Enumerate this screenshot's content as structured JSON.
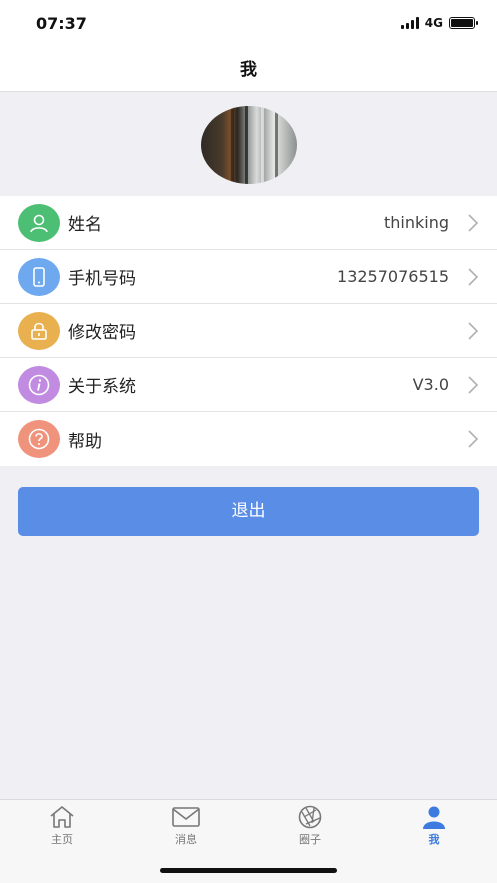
{
  "status_bar": {
    "time": "07:37",
    "network": "4G"
  },
  "nav": {
    "title": "我"
  },
  "profile": {
    "avatar_icon": "avatar-photo"
  },
  "menu": {
    "items": [
      {
        "label": "姓名",
        "value": "thinking",
        "icon": "user-icon",
        "color": "#4cbf74"
      },
      {
        "label": "手机号码",
        "value": "13257076515",
        "icon": "phone-icon",
        "color": "#6ea8ee"
      },
      {
        "label": "修改密码",
        "value": "",
        "icon": "lock-icon",
        "color": "#e9b04f"
      },
      {
        "label": "关于系统",
        "value": "V3.0",
        "icon": "info-icon",
        "color": "#c08be0"
      },
      {
        "label": "帮助",
        "value": "",
        "icon": "help-icon",
        "color": "#f0937c"
      }
    ]
  },
  "logout": {
    "label": "退出",
    "color": "#5a8ee6"
  },
  "tabs": [
    {
      "label": "主页",
      "icon": "home-icon",
      "active": false
    },
    {
      "label": "消息",
      "icon": "message-icon",
      "active": false
    },
    {
      "label": "圈子",
      "icon": "aperture-icon",
      "active": false
    },
    {
      "label": "我",
      "icon": "person-icon",
      "active": true
    }
  ],
  "accent_color": "#3d7be0"
}
